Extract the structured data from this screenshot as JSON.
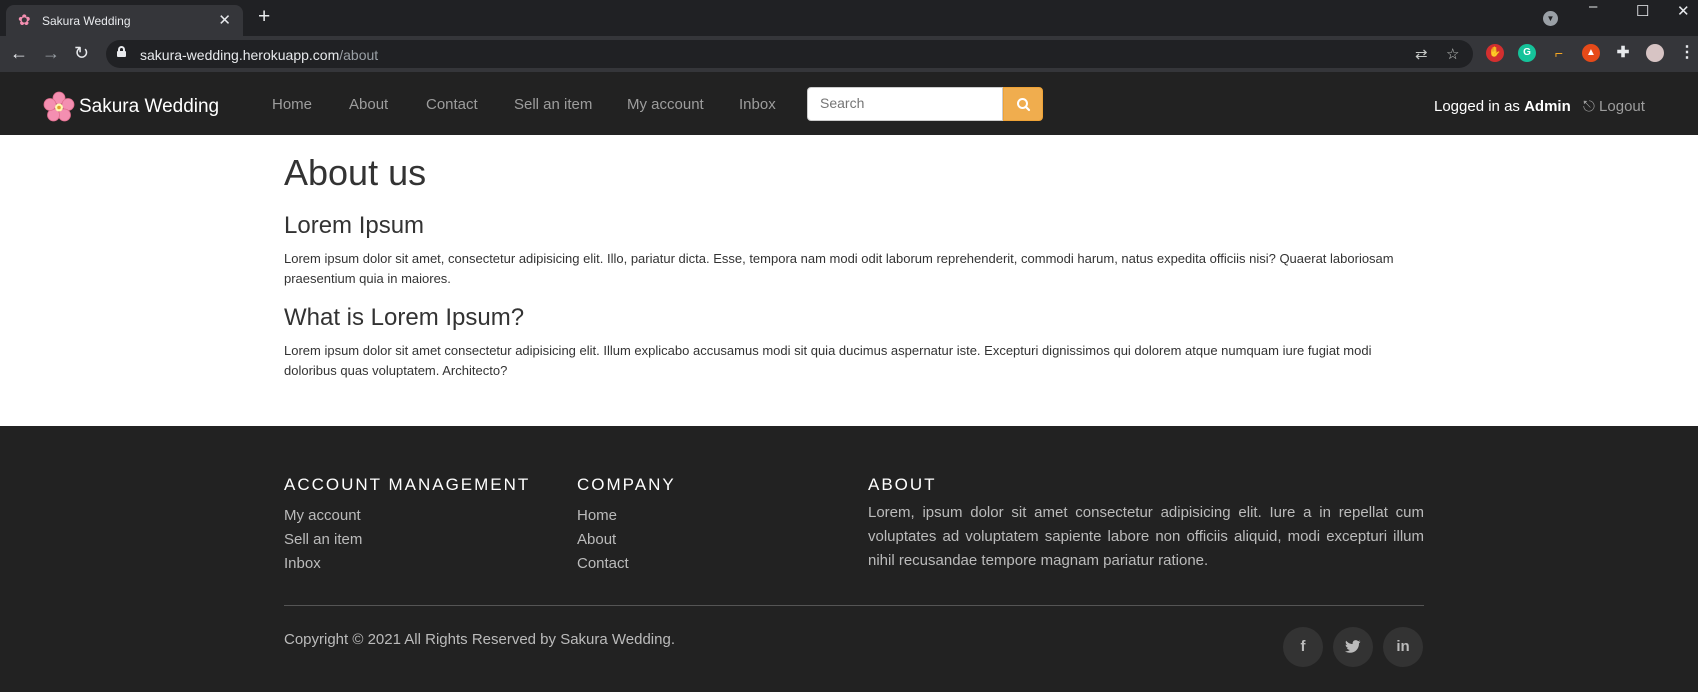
{
  "browser": {
    "tab_title": "Sakura Wedding",
    "url_host": "sakura-wedding.herokuapp.com",
    "url_path": "/about"
  },
  "nav": {
    "brand": "Sakura Wedding",
    "links": [
      "Home",
      "About",
      "Contact",
      "Sell an item",
      "My account",
      "Inbox"
    ],
    "search_placeholder": "Search",
    "logged_in_prefix": "Logged in as ",
    "user": "Admin",
    "logout": "Logout"
  },
  "main": {
    "title": "About us",
    "sections": [
      {
        "heading": "Lorem Ipsum",
        "text": "Lorem ipsum dolor sit amet, consectetur adipisicing elit. Illo, pariatur dicta. Esse, tempora nam modi odit laborum reprehenderit, commodi harum, natus expedita officiis nisi? Quaerat laboriosam praesentium quia in maiores."
      },
      {
        "heading": "What is Lorem Ipsum?",
        "text": "Lorem ipsum dolor sit amet consectetur adipisicing elit. Illum explicabo accusamus modi sit quia ducimus aspernatur iste. Excepturi dignissimos qui dolorem atque numquam iure fugiat modi doloribus quas voluptatem. Architecto?"
      }
    ]
  },
  "footer": {
    "account": {
      "heading": "ACCOUNT MANAGEMENT",
      "links": [
        "My account",
        "Sell an item",
        "Inbox"
      ]
    },
    "company": {
      "heading": "COMPANY",
      "links": [
        "Home",
        "About",
        "Contact"
      ]
    },
    "about": {
      "heading": "ABOUT",
      "text": "Lorem, ipsum dolor sit amet consectetur adipisicing elit. Iure a in repellat cum voluptates ad voluptatem sapiente labore non officiis aliquid, modi excepturi illum nihil recusandae tempore magnam pariatur ratione."
    },
    "copyright": "Copyright © 2021 All Rights Reserved by Sakura Wedding.",
    "social": [
      "facebook-icon",
      "twitter-icon",
      "linkedin-icon"
    ]
  },
  "colors": {
    "navbar_bg": "#222222",
    "accent": "#f0ad4e",
    "footer_bg": "#222222"
  }
}
